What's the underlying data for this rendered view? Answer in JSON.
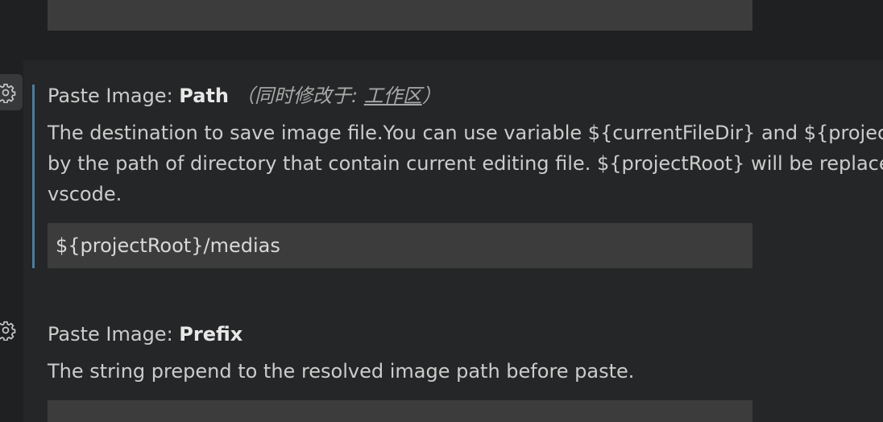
{
  "settings": [
    {
      "category": "Paste Image: ",
      "name": "Path",
      "modified_prefix": "（同时修改于: ",
      "modified_scope": "工作区",
      "modified_suffix": "）",
      "description_lines": [
        "The destination to save image file.You can use variable ${currentFileDir} and ${projectRo",
        "by the path of directory that contain current editing file. ${projectRoot} will be replace b",
        "vscode."
      ],
      "value": "${projectRoot}/medias",
      "gear_icon": "gear-icon"
    },
    {
      "category": "Paste Image: ",
      "name": "Prefix",
      "description_lines": [
        "The string prepend to the resolved image path before paste."
      ],
      "value": "",
      "gear_icon": "gear-icon"
    }
  ],
  "colors": {
    "background": "#1f2021",
    "setting_background": "#252627",
    "input_background": "#3c3c3c",
    "focus_bar": "#4a7da2"
  }
}
